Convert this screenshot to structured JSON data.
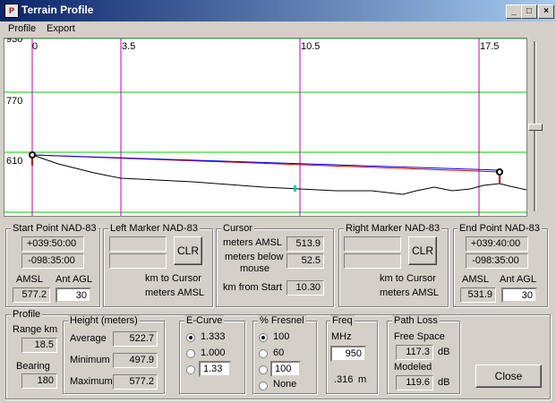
{
  "window": {
    "title": "Terrain Profile",
    "min": "_",
    "max": "□",
    "close": "×"
  },
  "menu": [
    {
      "label": "Profile"
    },
    {
      "label": "Export"
    }
  ],
  "plot": {
    "x_ticks": [
      {
        "label": "0",
        "km": 0
      },
      {
        "label": "3.5",
        "km": 3.5
      },
      {
        "label": "10.5",
        "km": 10.5
      },
      {
        "label": "17.5",
        "km": 17.5
      }
    ],
    "y_labels": [
      {
        "label": "930",
        "m": 930
      },
      {
        "label": "770",
        "m": 770
      },
      {
        "label": "610",
        "m": 610
      }
    ],
    "colors": {
      "grid": "#00cc00",
      "marker": "#c000c0",
      "terrain": "#000000",
      "ray": "#0000ff",
      "earth": "#cc0000",
      "cursor": "#00cccc"
    }
  },
  "start_point": {
    "title": "Start Point NAD-83",
    "lat": "+039:50:00",
    "lon": "-098:35:00",
    "amsl_label": "AMSL",
    "agl_label": "Ant AGL",
    "amsl": "577.2",
    "agl": "30"
  },
  "left_marker": {
    "title": "Left Marker NAD-83",
    "clr": "CLR",
    "km_label": "km to Cursor",
    "m_label": "meters AMSL"
  },
  "cursor": {
    "title": "Cursor",
    "amsl_label": "meters AMSL",
    "amsl": "513.9",
    "below_label1": "meters below",
    "below_label2": "mouse",
    "below": "52.5",
    "km_label": "km from Start",
    "km": "10.30"
  },
  "right_marker": {
    "title": "Right Marker NAD-83",
    "clr": "CLR",
    "km_label": "km to Cursor",
    "m_label": "meters AMSL"
  },
  "end_point": {
    "title": "End Point NAD-83",
    "lat": "+039:40:00",
    "lon": "-098:35:00",
    "amsl_label": "AMSL",
    "agl_label": "Ant AGL",
    "amsl": "531.9",
    "agl": "30"
  },
  "profile": {
    "title": "Profile",
    "range_label": "Range km",
    "range": "18.5",
    "bearing_label": "Bearing",
    "bearing": "180"
  },
  "height": {
    "title": "Height (meters)",
    "avg_label": "Average",
    "avg": "522.7",
    "min_label": "Minimum",
    "min": "497.9",
    "max_label": "Maximum",
    "max": "577.2"
  },
  "ecurve": {
    "title": "E-Curve",
    "opt1": "1.333",
    "opt2": "1.000",
    "custom": "1.33"
  },
  "fresnel": {
    "title": "% Fresnel",
    "opt1": "100",
    "opt2": "60",
    "custom": "100",
    "opt4": "None"
  },
  "freq": {
    "title": "Freq",
    "unit": "MHz",
    "value": "950",
    "wavelength": ".316",
    "wl_unit": "m"
  },
  "pathloss": {
    "title": "Path Loss",
    "fs_label": "Free Space",
    "fs": "117.3",
    "fs_unit": "dB",
    "mod_label": "Modeled",
    "mod": "119.6",
    "mod_unit": "dB"
  },
  "close_label": "Close"
}
